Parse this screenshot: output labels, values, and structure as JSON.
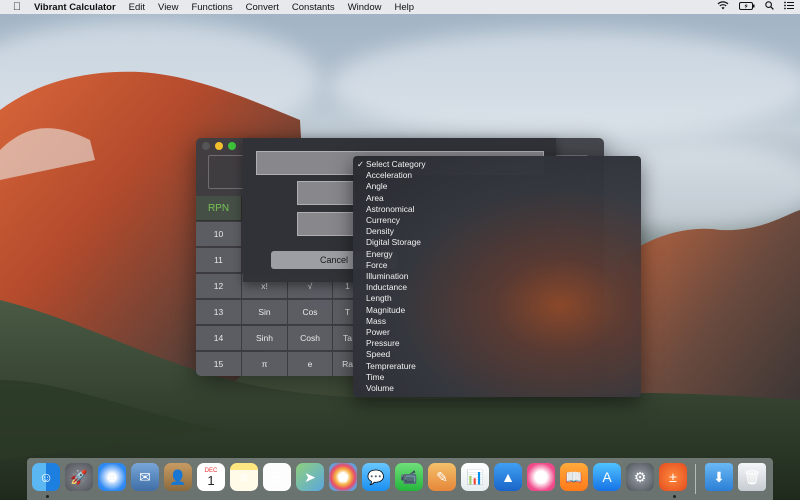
{
  "menubar": {
    "app_name": "Vibrant Calculator",
    "items": [
      "Edit",
      "View",
      "Functions",
      "Convert",
      "Constants",
      "Window",
      "Help"
    ],
    "status_icons": [
      "wifi-icon",
      "battery-icon",
      "search-icon",
      "list-icon"
    ]
  },
  "calculator": {
    "rpn_label": "RPN",
    "rows": [
      [
        "10",
        "",
        "",
        "",
        ""
      ],
      [
        "11",
        "",
        "",
        "",
        ""
      ],
      [
        "12",
        "x!",
        "√",
        "1",
        ""
      ],
      [
        "13",
        "Sin",
        "Cos",
        "T",
        ""
      ],
      [
        "14",
        "Sinh",
        "Cosh",
        "Ta",
        ""
      ],
      [
        "15",
        "π",
        "e",
        "Ra",
        ""
      ]
    ]
  },
  "sheet": {
    "cancel_label": "Cancel"
  },
  "category_menu": {
    "selected": "Select Category",
    "checkmark": "✓",
    "items": [
      "Select Category",
      "Acceleration",
      "Angle",
      "Area",
      "Astronomical",
      "Currency",
      "Density",
      "Digital Storage",
      "Energy",
      "Force",
      "Illumination",
      "Inductance",
      "Length",
      "Magnitude",
      "Mass",
      "Power",
      "Pressure",
      "Speed",
      "Temprerature",
      "Time",
      "Volume"
    ]
  },
  "dock": {
    "apps": [
      "finder-icon",
      "launchpad-icon",
      "safari-icon",
      "mail-icon",
      "contacts-icon",
      "calendar-icon",
      "notes-icon",
      "reminders-icon",
      "maps-icon",
      "photos-icon",
      "messages-icon",
      "facetime-icon",
      "pages-icon",
      "numbers-icon",
      "keynote-icon",
      "itunes-icon",
      "ibooks-icon",
      "app-store-icon",
      "system-preferences-icon",
      "calculator-icon",
      "downloads-icon",
      "trash-icon"
    ],
    "calendar_month": "DEC",
    "calendar_day": "1"
  }
}
